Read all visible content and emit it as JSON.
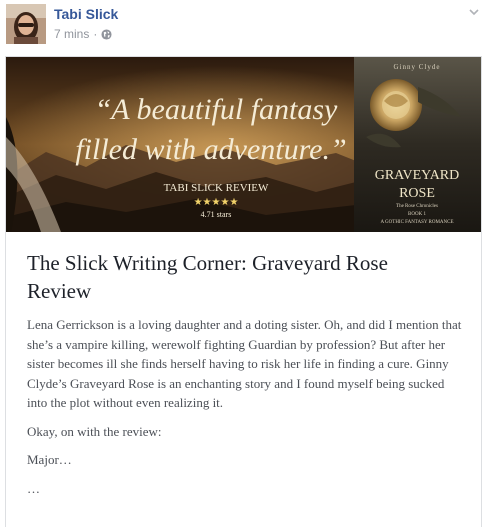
{
  "post": {
    "author": "Tabi Slick",
    "time": "7 mins",
    "separator": "·",
    "privacy_icon": "globe-icon",
    "options_icon": "chevron-down-icon"
  },
  "banner": {
    "quote_line1": "“A beautiful fantasy",
    "quote_line2": "filled with adventure.”",
    "review_label": "TABI SLICK REVIEW",
    "stars": "★★★★★",
    "rating_text": "4.71 stars",
    "book_title_line1": "GRAVEYARD",
    "book_title_line2": "ROSE",
    "book_author_top": "Ginny Clyde",
    "book_series": "The Rose Chronicles",
    "book_number": "BOOK 1",
    "book_genre": "A GOTHIC FANTASY ROMANCE"
  },
  "article": {
    "title": "The Slick Writing Corner: Graveyard Rose Review",
    "paragraphs": [
      "Lena Gerrickson is a loving daughter and a doting sister. Oh, and did I mention that she’s a vampire killing, werewolf fighting Guardian by profession? But after her sister becomes ill she finds herself having to risk her life in finding a cure. Ginny Clyde’s Graveyard Rose is an enchanting story and I found myself being sucked into the plot without even realizing it.",
      "Okay, on with the review:",
      "Major…",
      "…"
    ]
  },
  "colors": {
    "author_link": "#365899",
    "meta_text": "#90949c",
    "title_text": "#1d2129",
    "body_text": "#4b4f56",
    "card_border": "#dddfe2"
  }
}
